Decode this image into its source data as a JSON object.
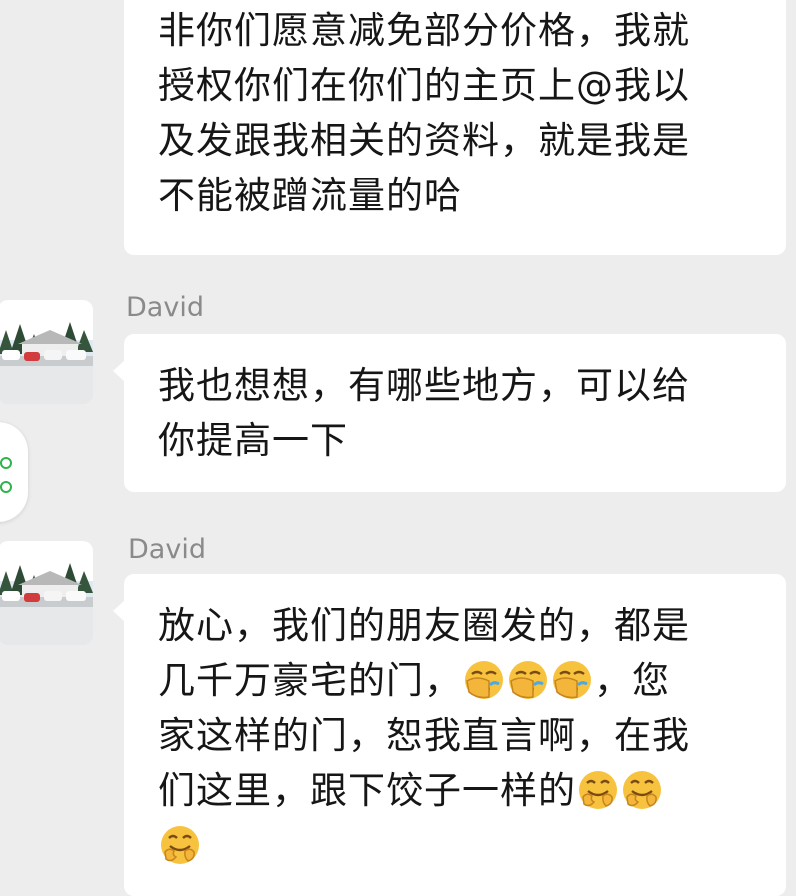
{
  "messages": [
    {
      "sender": "",
      "lines": [
        "非你们愿意减免部分价格，我就",
        "授权你们在你们的主页上@我以",
        "及发跟我相关的资料，就是我是",
        "不能被蹭流量的哈"
      ]
    },
    {
      "sender": "David",
      "lines": [
        "我也想想，有哪些地方，可以给",
        "你提高一下"
      ]
    },
    {
      "sender": "David",
      "lines": [
        "放心，我们的朋友圈发的，都是",
        "几千万豪宅的门，",
        "，您",
        "家这样的门，恕我直言啊，在我",
        "们这里，跟下饺子一样的"
      ],
      "emojis": [
        "facepalm-emoji",
        "facepalm-emoji",
        "facepalm-emoji",
        "awkward-emoji",
        "awkward-emoji",
        "awkward-emoji"
      ]
    }
  ],
  "colors": {
    "background": "#ededed",
    "bubble": "#ffffff",
    "sender_name": "#8a8a8a",
    "text": "#161616"
  }
}
